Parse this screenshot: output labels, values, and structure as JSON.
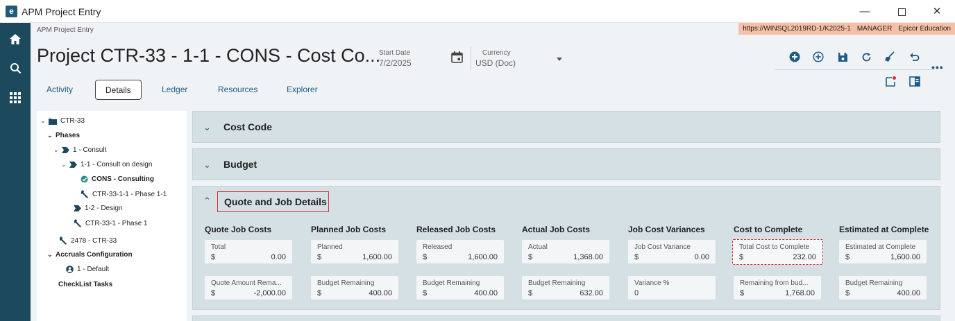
{
  "window": {
    "title": "APM Project Entry"
  },
  "header": {
    "breadcrumb": "APM Project Entry",
    "env": {
      "server": "https://WINSQL2019RD-1/K2025-1",
      "user": "MANAGER",
      "company": "Epicor Education"
    },
    "title": "Project CTR-33 - 1-1 - CONS - Cost Co...",
    "start_date_label": "Start Date",
    "start_date_value": "7/2/2025",
    "currency_label": "Currency",
    "currency_value": "USD (Doc)"
  },
  "tabs": [
    "Activity",
    "Details",
    "Ledger",
    "Resources",
    "Explorer"
  ],
  "tree": {
    "root": "CTR-33",
    "phases": "Phases",
    "n1": "1 - Consult",
    "n11": "1-1 - Consult on design",
    "cons": "CONS - Consulting",
    "ctr3311": "CTR-33-1-1 - Phase 1-1",
    "n12": "1-2 - Design",
    "ctr331": "CTR-33-1 - Phase 1",
    "job2478": "2478 - CTR-33",
    "accruals": "Accruals Configuration",
    "default": "1 - Default",
    "checklist": "CheckList Tasks"
  },
  "panels": {
    "cost_code": "Cost Code",
    "budget": "Budget",
    "quote": "Quote and Job Details"
  },
  "columns": [
    {
      "head": "Quote Job Costs",
      "c1": {
        "label": "Total",
        "currency": "$",
        "value": "0.00"
      },
      "c2": {
        "label": "Quote Amount Rema...",
        "currency": "$",
        "value": "-2,000.00"
      }
    },
    {
      "head": "Planned Job Costs",
      "c1": {
        "label": "Planned",
        "currency": "$",
        "value": "1,600.00"
      },
      "c2": {
        "label": "Budget Remaining",
        "currency": "$",
        "value": "400.00"
      }
    },
    {
      "head": "Released Job Costs",
      "c1": {
        "label": "Released",
        "currency": "$",
        "value": "1,600.00"
      },
      "c2": {
        "label": "Budget Remaining",
        "currency": "$",
        "value": "400.00"
      }
    },
    {
      "head": "Actual Job Costs",
      "c1": {
        "label": "Actual",
        "currency": "$",
        "value": "1,368.00"
      },
      "c2": {
        "label": "Budget Remaining",
        "currency": "$",
        "value": "632.00"
      }
    },
    {
      "head": "Job Cost Variances",
      "c1": {
        "label": "Job Cost Variance",
        "currency": "$",
        "value": "0.00"
      },
      "c2": {
        "label": "Variance %",
        "currency": "0",
        "value": ""
      }
    },
    {
      "head": "Cost to Complete",
      "c1": {
        "label": "Total Cost to Complete",
        "currency": "$",
        "value": "232.00"
      },
      "c2": {
        "label": "Remaining from bud...",
        "currency": "$",
        "value": "1,768.00"
      }
    },
    {
      "head": "Estimated at Complete",
      "c1": {
        "label": "Estimated at Complete",
        "currency": "$",
        "value": "1,600.00"
      },
      "c2": {
        "label": "Budget Remaining",
        "currency": "$",
        "value": "400.00"
      }
    }
  ],
  "icons": [
    "home-icon",
    "search-icon",
    "apps-grid-icon",
    "calendar-icon",
    "add-filled-icon",
    "add-outline-icon",
    "save-icon",
    "refresh-icon",
    "clear-icon",
    "undo-icon",
    "more-icon",
    "notes-icon",
    "panel-icon"
  ],
  "colors": {
    "rail": "#1c4a5c",
    "accent": "#1c5a8a",
    "highlight": "#d03030",
    "env_badge": "#f7c0a6"
  }
}
